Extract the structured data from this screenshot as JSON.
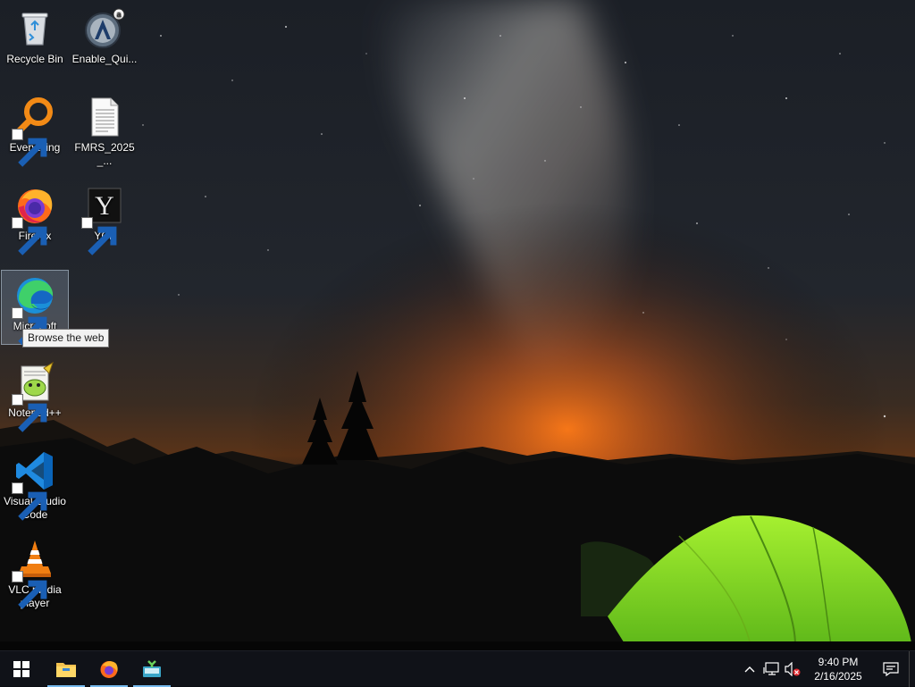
{
  "desktop": {
    "icons": [
      {
        "label": "Recycle Bin",
        "icon": "recycle-bin-icon",
        "shortcut": false
      },
      {
        "label": "Enable_Qui...",
        "icon": "aimp-icon",
        "shortcut": false
      },
      {
        "label": "Everything",
        "icon": "everything-search-icon",
        "shortcut": true
      },
      {
        "label": "FMRS_2025_...",
        "icon": "text-document-icon",
        "shortcut": false
      },
      {
        "label": "Firefox",
        "icon": "firefox-icon",
        "shortcut": true
      },
      {
        "label": "YCL",
        "icon": "ycl-icon",
        "shortcut": true,
        "glyph_text": "Y"
      },
      {
        "label": "Microsoft",
        "icon": "edge-icon",
        "shortcut": true,
        "selected": true
      },
      {
        "label": "Notepad++",
        "icon": "notepadpp-icon",
        "shortcut": true
      },
      {
        "label": "Visual Studio Code",
        "icon": "vscode-icon",
        "shortcut": true
      },
      {
        "label": "VLC media player",
        "icon": "vlc-icon",
        "shortcut": true
      }
    ],
    "tooltip": "Browse the web"
  },
  "taskbar": {
    "start": "windows-start-icon",
    "pinned": [
      {
        "name": "file-explorer-icon",
        "running": true
      },
      {
        "name": "firefox-icon",
        "running": true
      },
      {
        "name": "app-icon",
        "running": true
      }
    ],
    "tray": {
      "overflow": "chevron-up-icon",
      "network": "network-icon",
      "volume": "volume-muted-icon",
      "time": "9:40 PM",
      "date": "2/16/2025",
      "notifications": "action-center-icon"
    }
  },
  "colors": {
    "taskbar": "#101218",
    "accent": "#76b9ed",
    "tent": "#8fe02a"
  }
}
